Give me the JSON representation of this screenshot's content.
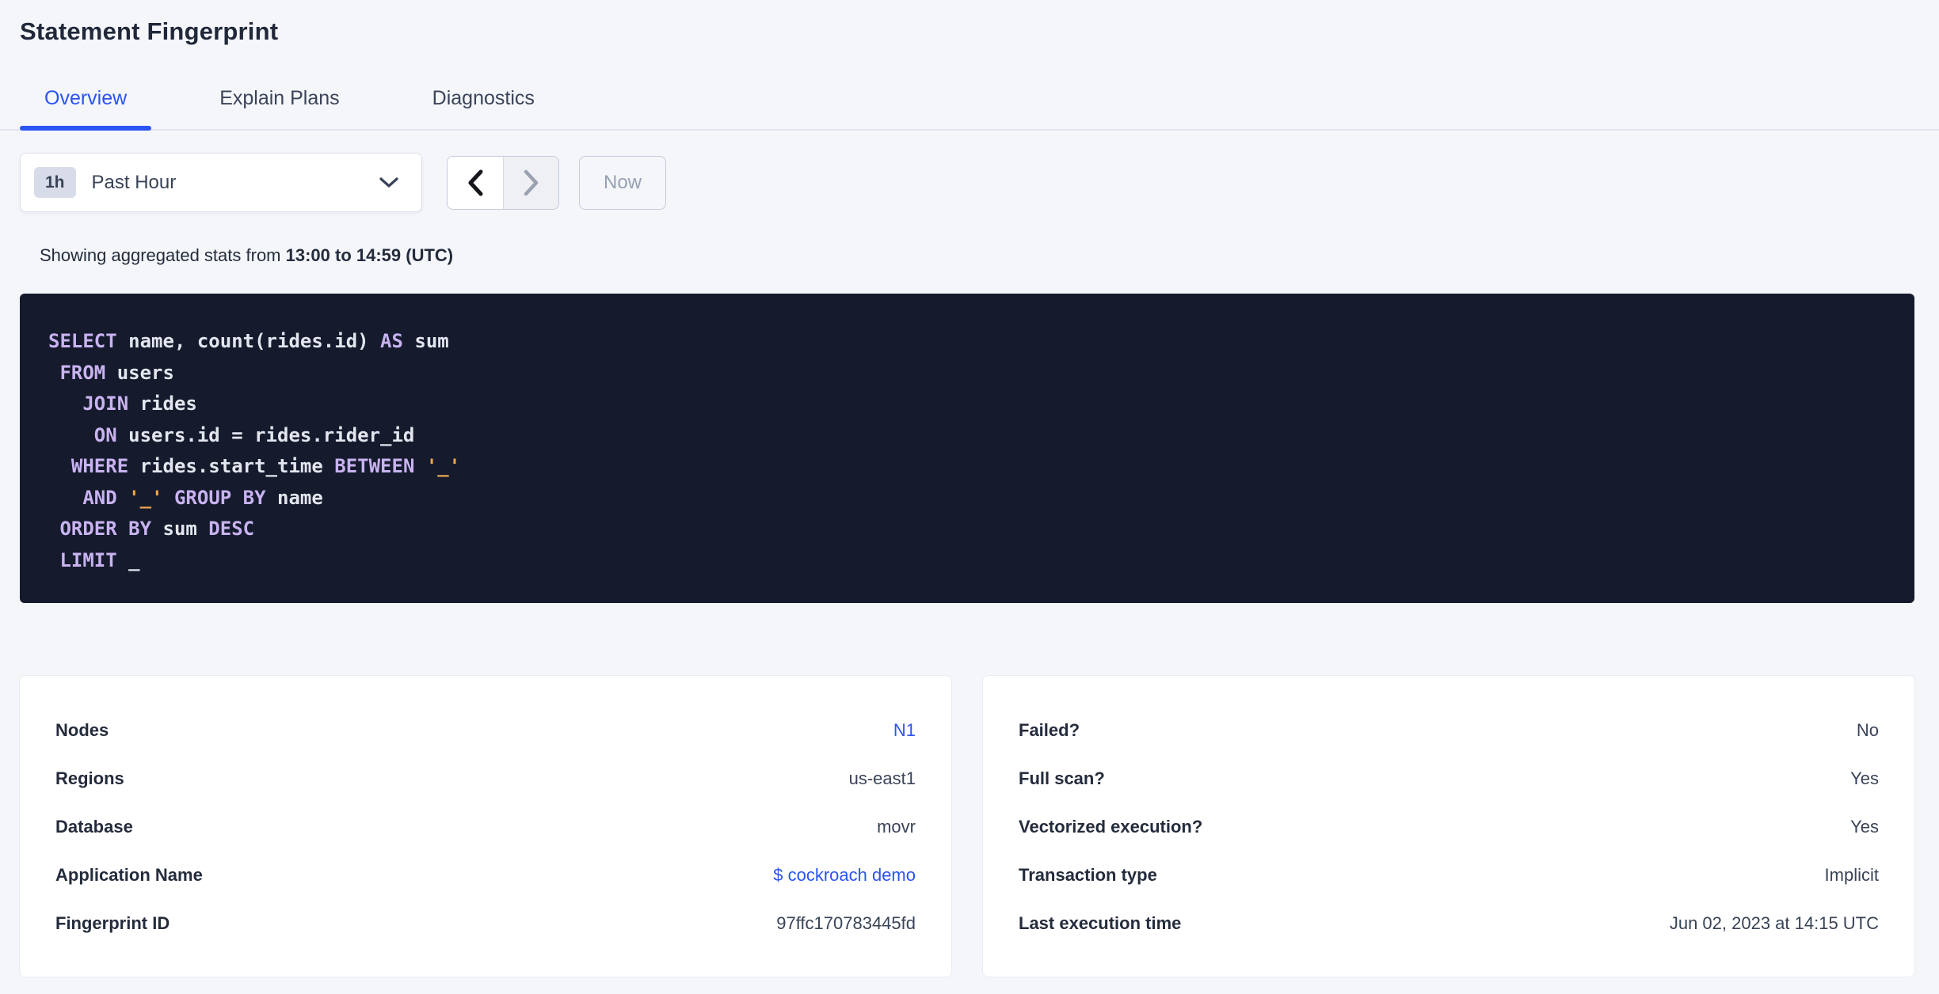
{
  "page": {
    "title": "Statement Fingerprint"
  },
  "tabs": [
    {
      "label": "Overview",
      "active": true
    },
    {
      "label": "Explain Plans",
      "active": false
    },
    {
      "label": "Diagnostics",
      "active": false
    }
  ],
  "time_picker": {
    "interval_badge": "1h",
    "selected_label": "Past Hour",
    "now_label": "Now",
    "prev_enabled": true,
    "next_enabled": false
  },
  "stats_line": {
    "prefix": "Showing aggregated stats from ",
    "range_bold": "13:00 to 14:59 (UTC)"
  },
  "sql": {
    "lines": [
      [
        {
          "t": "SELECT",
          "c": "kw"
        },
        {
          "t": " name, count(rides.id) ",
          "c": "pl"
        },
        {
          "t": "AS",
          "c": "kw"
        },
        {
          "t": " sum",
          "c": "pl"
        }
      ],
      [
        {
          "t": " ",
          "c": "pl"
        },
        {
          "t": "FROM",
          "c": "kw"
        },
        {
          "t": " users",
          "c": "pl"
        }
      ],
      [
        {
          "t": "   ",
          "c": "pl"
        },
        {
          "t": "JOIN",
          "c": "kw"
        },
        {
          "t": " rides",
          "c": "pl"
        }
      ],
      [
        {
          "t": "    ",
          "c": "pl"
        },
        {
          "t": "ON",
          "c": "kw"
        },
        {
          "t": " users.id = rides.rider_id",
          "c": "pl"
        }
      ],
      [
        {
          "t": "  ",
          "c": "pl"
        },
        {
          "t": "WHERE",
          "c": "kw"
        },
        {
          "t": " rides.start_time ",
          "c": "pl"
        },
        {
          "t": "BETWEEN",
          "c": "kw"
        },
        {
          "t": " ",
          "c": "pl"
        },
        {
          "t": "'_'",
          "c": "str"
        }
      ],
      [
        {
          "t": "   ",
          "c": "pl"
        },
        {
          "t": "AND",
          "c": "kw"
        },
        {
          "t": " ",
          "c": "pl"
        },
        {
          "t": "'_'",
          "c": "str"
        },
        {
          "t": " ",
          "c": "pl"
        },
        {
          "t": "GROUP BY",
          "c": "kw"
        },
        {
          "t": " name",
          "c": "pl"
        }
      ],
      [
        {
          "t": " ",
          "c": "pl"
        },
        {
          "t": "ORDER BY",
          "c": "kw"
        },
        {
          "t": " sum ",
          "c": "pl"
        },
        {
          "t": "DESC",
          "c": "kw"
        }
      ],
      [
        {
          "t": " ",
          "c": "pl"
        },
        {
          "t": "LIMIT",
          "c": "kw"
        },
        {
          "t": " _",
          "c": "pl"
        }
      ]
    ]
  },
  "cards": {
    "left": {
      "rows": [
        {
          "label": "Nodes",
          "value": "N1",
          "link": true
        },
        {
          "label": "Regions",
          "value": "us-east1",
          "link": false
        },
        {
          "label": "Database",
          "value": "movr",
          "link": false
        },
        {
          "label": "Application Name",
          "value": "$ cockroach demo",
          "link": true
        },
        {
          "label": "Fingerprint ID",
          "value": "97ffc170783445fd",
          "link": false
        }
      ]
    },
    "right": {
      "rows": [
        {
          "label": "Failed?",
          "value": "No",
          "link": false
        },
        {
          "label": "Full scan?",
          "value": "Yes",
          "link": false
        },
        {
          "label": "Vectorized execution?",
          "value": "Yes",
          "link": false
        },
        {
          "label": "Transaction type",
          "value": "Implicit",
          "link": false
        },
        {
          "label": "Last execution time",
          "value": "Jun 02, 2023 at 14:15 UTC",
          "link": false
        }
      ]
    }
  },
  "colors": {
    "accent_blue": "#2b54f2",
    "page_background": "#f4f6fa",
    "code_background": "#151a2d",
    "code_keyword": "#c8b3f0",
    "code_plain": "#e3e6ee",
    "code_literal": "#efa64c",
    "disabled_text": "#97a1b4"
  }
}
